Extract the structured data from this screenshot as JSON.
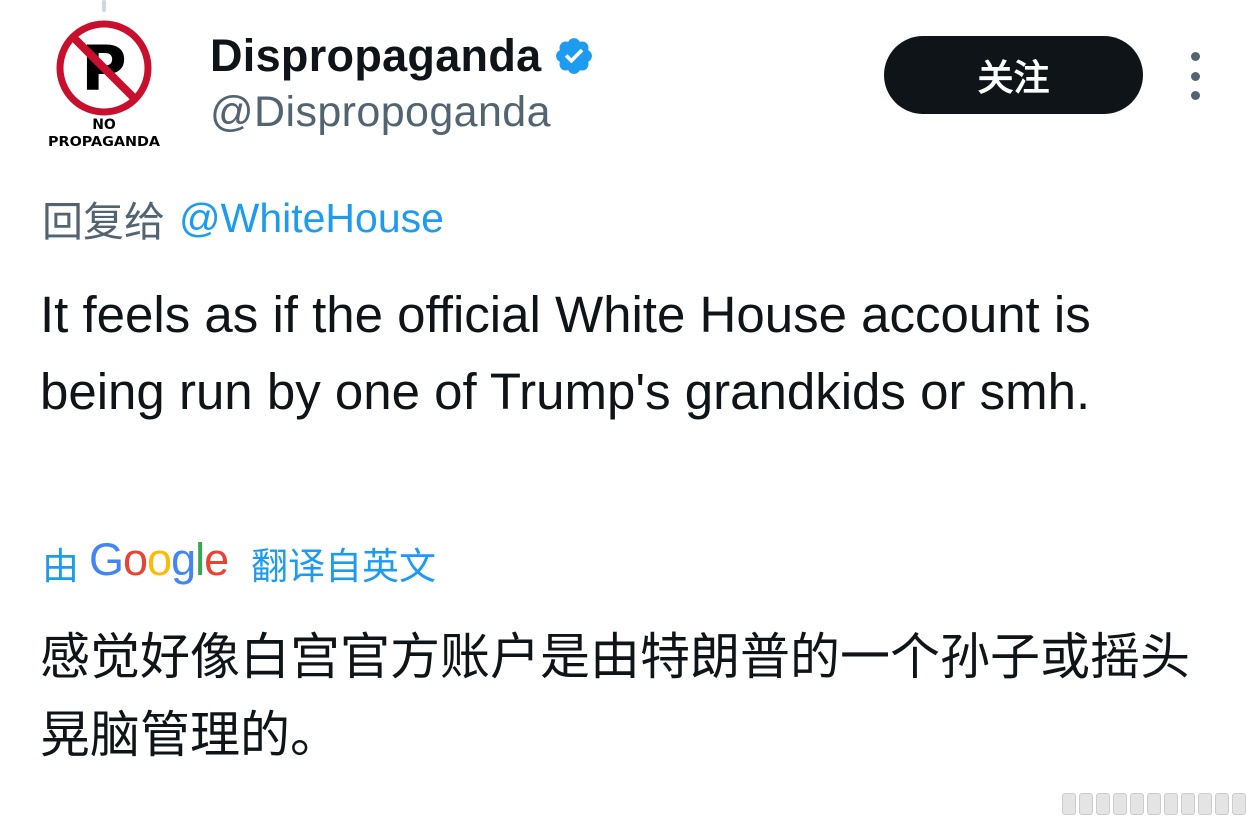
{
  "tweet": {
    "author": {
      "display_name": "Dispropaganda",
      "handle": "@Dispropoganda",
      "verified": true,
      "avatar_text_line1": "NO",
      "avatar_text_line2": "PROPAGANDA"
    },
    "follow_label": "关注",
    "reply_to_prefix": "回复给",
    "reply_to_handle": "@WhiteHouse",
    "text": "It feels as if the official White House account is being run by one of Trump's grandkids or smh.",
    "translation": {
      "by_label": "由",
      "provider": "Google",
      "from_label": "翻译自英文",
      "text": "感觉好像白宫官方账户是由特朗普的一个孙子或摇头晃脑管理的。"
    }
  },
  "colors": {
    "text_primary": "#0f1419",
    "text_secondary": "#536471",
    "link_blue": "#1d9bf0",
    "button_dark": "#0f1419",
    "verified_blue": "#1d9bf0",
    "avatar_red": "#c8102e"
  },
  "icons": {
    "verified": "verified-badge-icon",
    "more": "more-vertical-icon"
  }
}
